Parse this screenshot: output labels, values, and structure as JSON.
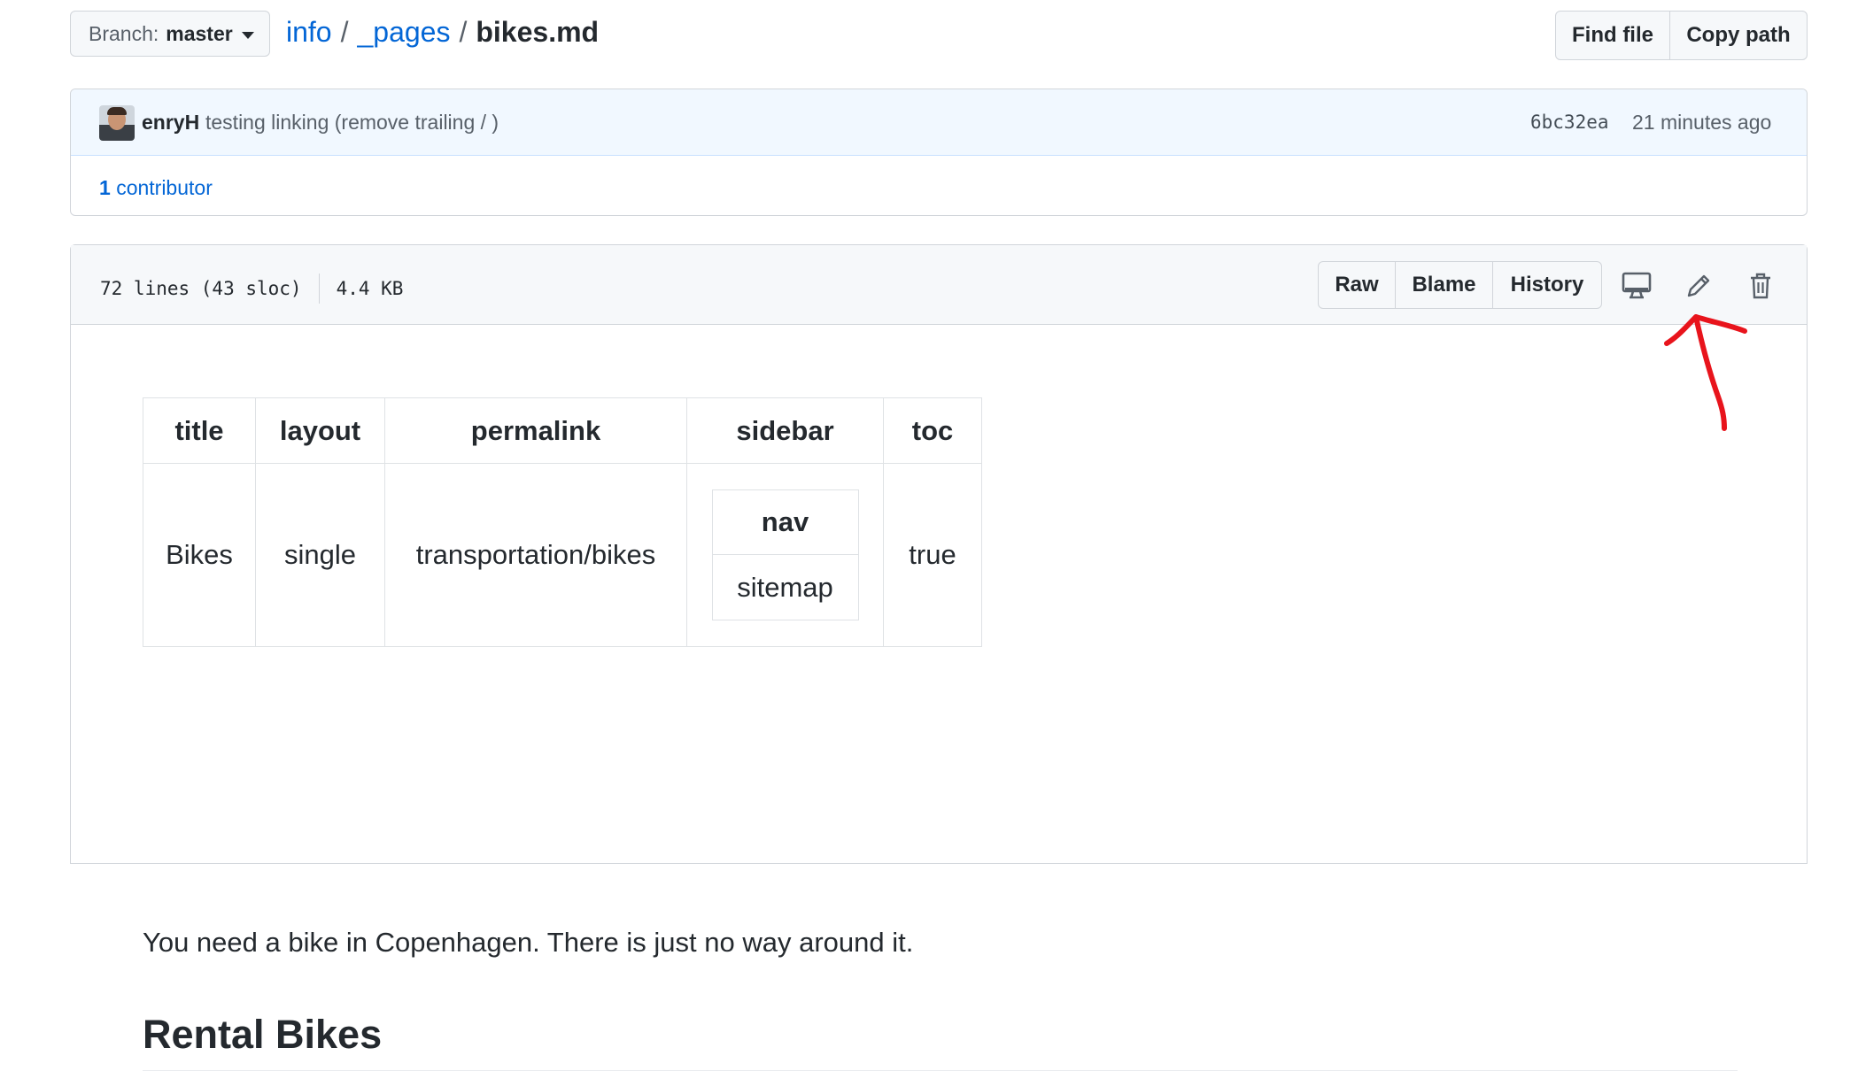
{
  "branch": {
    "prefix": "Branch:",
    "name": "master"
  },
  "breadcrumb": {
    "root": "info",
    "folder": "_pages",
    "file": "bikes.md",
    "separator": "/"
  },
  "top_actions": {
    "find_file": "Find file",
    "copy_path": "Copy path"
  },
  "commit": {
    "author": "enryH",
    "message": "testing linking (remove trailing / )",
    "sha": "6bc32ea",
    "time": "21 minutes ago",
    "contributors_count": "1",
    "contributors_label": "contributor"
  },
  "file": {
    "lines": "72 lines (43 sloc)",
    "size": "4.4 KB",
    "actions": {
      "raw": "Raw",
      "blame": "Blame",
      "history": "History"
    },
    "icons": [
      "desktop-icon",
      "pencil-icon",
      "trash-icon"
    ]
  },
  "frontmatter": {
    "headers": [
      "title",
      "layout",
      "permalink",
      "sidebar",
      "toc"
    ],
    "values": {
      "title": "Bikes",
      "layout": "single",
      "permalink": "transportation/bikes",
      "toc": "true"
    },
    "sidebar_table": {
      "header": "nav",
      "value": "sitemap"
    }
  },
  "content": {
    "paragraph": "You need a bike in Copenhagen. There is just no way around it.",
    "heading": "Rental Bikes"
  },
  "colors": {
    "link": "#0366d6",
    "annotation": "#e8141c",
    "commit_bg": "#f1f8ff",
    "header_bg": "#f6f8fa"
  }
}
